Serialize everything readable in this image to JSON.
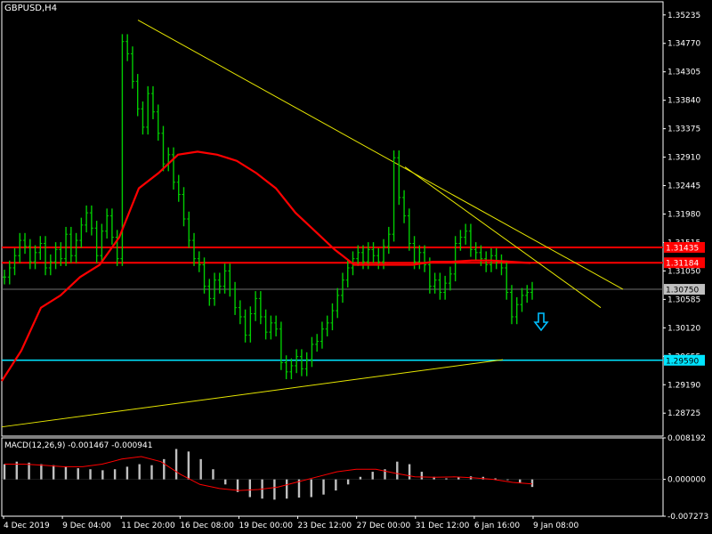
{
  "symbol_label": "GBPUSD,H4",
  "macd_label": "MACD(12,26,9) -0.001467 -0.000941",
  "colors": {
    "background": "#000000",
    "grid_border": "#ffffff",
    "candles": "#00cc00",
    "moving_average": "#ff0000",
    "horizontal_levels": "#ff0000",
    "support_line": "#00e5ff",
    "trendlines": "#e6e600",
    "macd_histogram": "#c0c0c0",
    "macd_signal": "#ff0000",
    "current_price_tag": "#c0c0c0",
    "arrow": "#00bfff"
  },
  "arrow_icon": "down-arrow-icon",
  "chart_data": [
    {
      "type": "line",
      "title": "GBPUSD,H4",
      "ylim": [
        1.2835,
        1.3545
      ],
      "price_axis_ticks": [
        "1.35235",
        "1.34770",
        "1.34305",
        "1.33840",
        "1.33375",
        "1.32910",
        "1.32445",
        "1.31980",
        "1.31515",
        "1.31050",
        "1.30585",
        "1.30120",
        "1.29655",
        "1.29190",
        "1.28725"
      ],
      "time_axis_labels": [
        "4 Dec 2019",
        "9 Dec 04:00",
        "11 Dec 20:00",
        "16 Dec 08:00",
        "19 Dec 00:00",
        "23 Dec 12:00",
        "27 Dec 00:00",
        "31 Dec 12:00",
        "6 Jan 16:00",
        "9 Jan 08:00"
      ],
      "series": [
        {
          "values": [
            1.3095,
            1.311,
            1.313,
            1.3155,
            1.3145,
            1.312,
            1.3135,
            1.315,
            1.311,
            1.312,
            1.314,
            1.3125,
            1.3165,
            1.313,
            1.3155,
            1.318,
            1.32,
            1.3175,
            1.313,
            1.317,
            1.3195,
            1.316,
            1.3125,
            1.348,
            1.346,
            1.3415,
            1.337,
            1.334,
            1.3395,
            1.3365,
            1.333,
            1.328,
            1.3295,
            1.325,
            1.323,
            1.319,
            1.3155,
            1.3125,
            1.3115,
            1.308,
            1.306,
            1.309,
            1.308,
            1.3105,
            1.3075,
            1.3045,
            1.303,
            1.3,
            1.3035,
            1.306,
            1.303,
            1.3005,
            1.302,
            1.301,
            1.2955,
            1.294,
            1.295,
            1.2965,
            1.2945,
            1.296,
            1.2985,
            1.299,
            1.301,
            1.302,
            1.304,
            1.3065,
            1.309,
            1.311,
            1.3125,
            1.3135,
            1.312,
            1.314,
            1.313,
            1.312,
            1.3145,
            1.3165,
            1.329,
            1.3225,
            1.3195,
            1.315,
            1.312,
            1.3135,
            1.3115,
            1.308,
            1.309,
            1.307,
            1.3085,
            1.31,
            1.315,
            1.316,
            1.317,
            1.314,
            1.3135,
            1.3125,
            1.3115,
            1.313,
            1.312,
            1.311,
            1.307,
            1.303,
            1.305,
            1.3065,
            1.307,
            1.3075
          ]
        },
        {
          "name": "moving-average",
          "values": [
            1.2925,
            1.2975,
            1.3045,
            1.3065,
            1.3095,
            1.3115,
            1.316,
            1.324,
            1.3265,
            1.3295,
            1.33,
            1.3295,
            1.3285,
            1.3265,
            1.324,
            1.32,
            1.317,
            1.314,
            1.3115,
            1.3115,
            1.3115,
            1.3115,
            1.312,
            1.312,
            1.3122,
            1.3122,
            1.312,
            1.3118
          ]
        }
      ],
      "horizontal_levels": [
        {
          "price": 1.31435,
          "label": "1.31435"
        },
        {
          "price": 1.31184,
          "label": "1.31184"
        },
        {
          "price": 1.2959,
          "label": "1.29590"
        }
      ],
      "current_price": {
        "price": 1.3075,
        "label": "1.30750"
      },
      "trendlines": [
        {
          "from": [
            "11 Dec 20:00",
            1.3515
          ],
          "to": [
            "9 Jan 08:00+",
            1.3075
          ]
        },
        {
          "from": [
            "31 Dec 12:00",
            1.3275
          ],
          "to": [
            "9 Jan 08:00+",
            1.3045
          ]
        },
        {
          "from": [
            "4 Dec 2019",
            1.285
          ],
          "to": [
            "9 Jan 08:00",
            1.296
          ]
        }
      ]
    },
    {
      "type": "bar",
      "title": "MACD(12,26,9) -0.001467 -0.000941",
      "ylim": [
        -0.00727,
        0.00819
      ],
      "axis_ticks": [
        "0.008192",
        "0.000000",
        "-0.007273"
      ],
      "histogram": [
        0.003,
        0.0035,
        0.0033,
        0.003,
        0.0028,
        0.0025,
        0.0022,
        0.002,
        0.0018,
        0.002,
        0.0025,
        0.003,
        0.0028,
        0.004,
        0.006,
        0.0055,
        0.004,
        0.002,
        -0.001,
        -0.0025,
        -0.0035,
        -0.0038,
        -0.004,
        -0.0038,
        -0.0036,
        -0.0035,
        -0.003,
        -0.0022,
        -0.001,
        0.0005,
        0.0015,
        0.002,
        0.0035,
        0.003,
        0.0015,
        0.0005,
        0.0002,
        0.0004,
        0.0006,
        0.0005,
        0.0002,
        0.0,
        -0.0007,
        -0.0015
      ],
      "signal": [
        0.003,
        0.003,
        0.0028,
        0.0025,
        0.0025,
        0.003,
        0.004,
        0.0045,
        0.0035,
        0.001,
        -0.001,
        -0.0018,
        -0.0022,
        -0.002,
        -0.0015,
        -0.0005,
        0.0005,
        0.0015,
        0.002,
        0.002,
        0.0012,
        0.0005,
        0.0004,
        0.0005,
        0.0003,
        0.0,
        -0.0006,
        -0.0009
      ]
    }
  ]
}
